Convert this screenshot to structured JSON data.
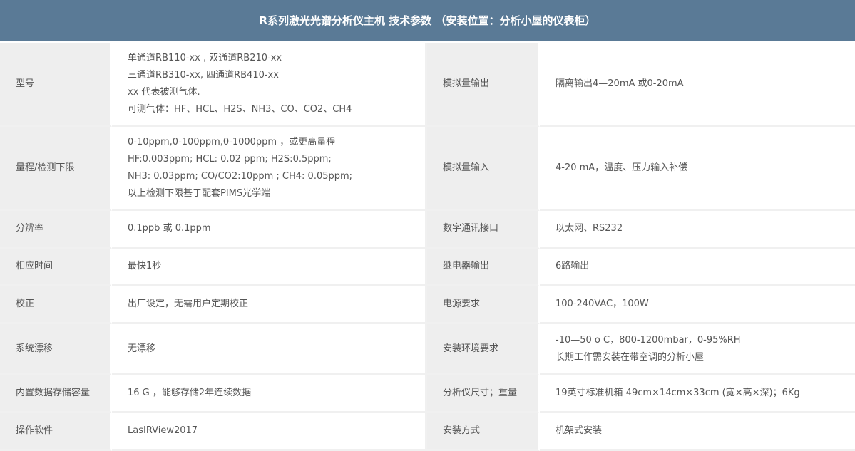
{
  "title": "R系列激光光谱分析仪主机 技术参数 （安装位置：分析小屋的仪表柜）",
  "rows": [
    {
      "left_label": "型号",
      "left_value": [
        "单通道RB110-xx , 双通道RB210-xx",
        "三通道RB310-xx, 四通道RB410-xx",
        "xx 代表被测气体.",
        "可测气体：HF、HCL、H2S、NH3、CO、CO2、CH4"
      ],
      "right_label": "模拟量输出",
      "right_value": [
        "隔离输出4—20mA 或0-20mA"
      ]
    },
    {
      "left_label": "量程/检测下限",
      "left_value": [
        "0-10ppm,0-100ppm,0-1000ppm ，或更高量程",
        "HF:0.003ppm; HCL: 0.02 ppm; H2S:0.5ppm;",
        "NH3: 0.03ppm; CO/CO2:10ppm ; CH4: 0.05ppm;",
        "以上检测下限基于配套PIMS光学端"
      ],
      "right_label": "模拟量输入",
      "right_value": [
        "4-20 mA，温度、压力输入补偿"
      ]
    },
    {
      "left_label": "分辨率",
      "left_value": [
        "0.1ppb 或 0.1ppm"
      ],
      "right_label": "数字通讯接口",
      "right_value": [
        "以太网、RS232"
      ]
    },
    {
      "left_label": "相应时间",
      "left_value": [
        "最快1秒"
      ],
      "right_label": "继电器输出",
      "right_value": [
        "6路输出"
      ]
    },
    {
      "left_label": "校正",
      "left_value": [
        "出厂设定，无需用户定期校正"
      ],
      "right_label": "电源要求",
      "right_value": [
        "100-240VAC，100W"
      ]
    },
    {
      "left_label": "系统漂移",
      "left_value": [
        "无漂移"
      ],
      "right_label": "安装环境要求",
      "right_value": [
        "-10—50 o C，800-1200mbar，0-95%RH",
        "长期工作需安装在带空调的分析小屋"
      ]
    },
    {
      "left_label": "内置数据存储容量",
      "left_value": [
        "16 G ，能够存储2年连续数据"
      ],
      "right_label": "分析仪尺寸；重量",
      "right_value": [
        "19英寸标准机箱 49cm×14cm×33cm (宽×高×深)；6Kg"
      ]
    },
    {
      "left_label": "操作软件",
      "left_value": [
        "LasIRView2017"
      ],
      "right_label": "安装方式",
      "right_value": [
        "机架式安装"
      ]
    }
  ]
}
